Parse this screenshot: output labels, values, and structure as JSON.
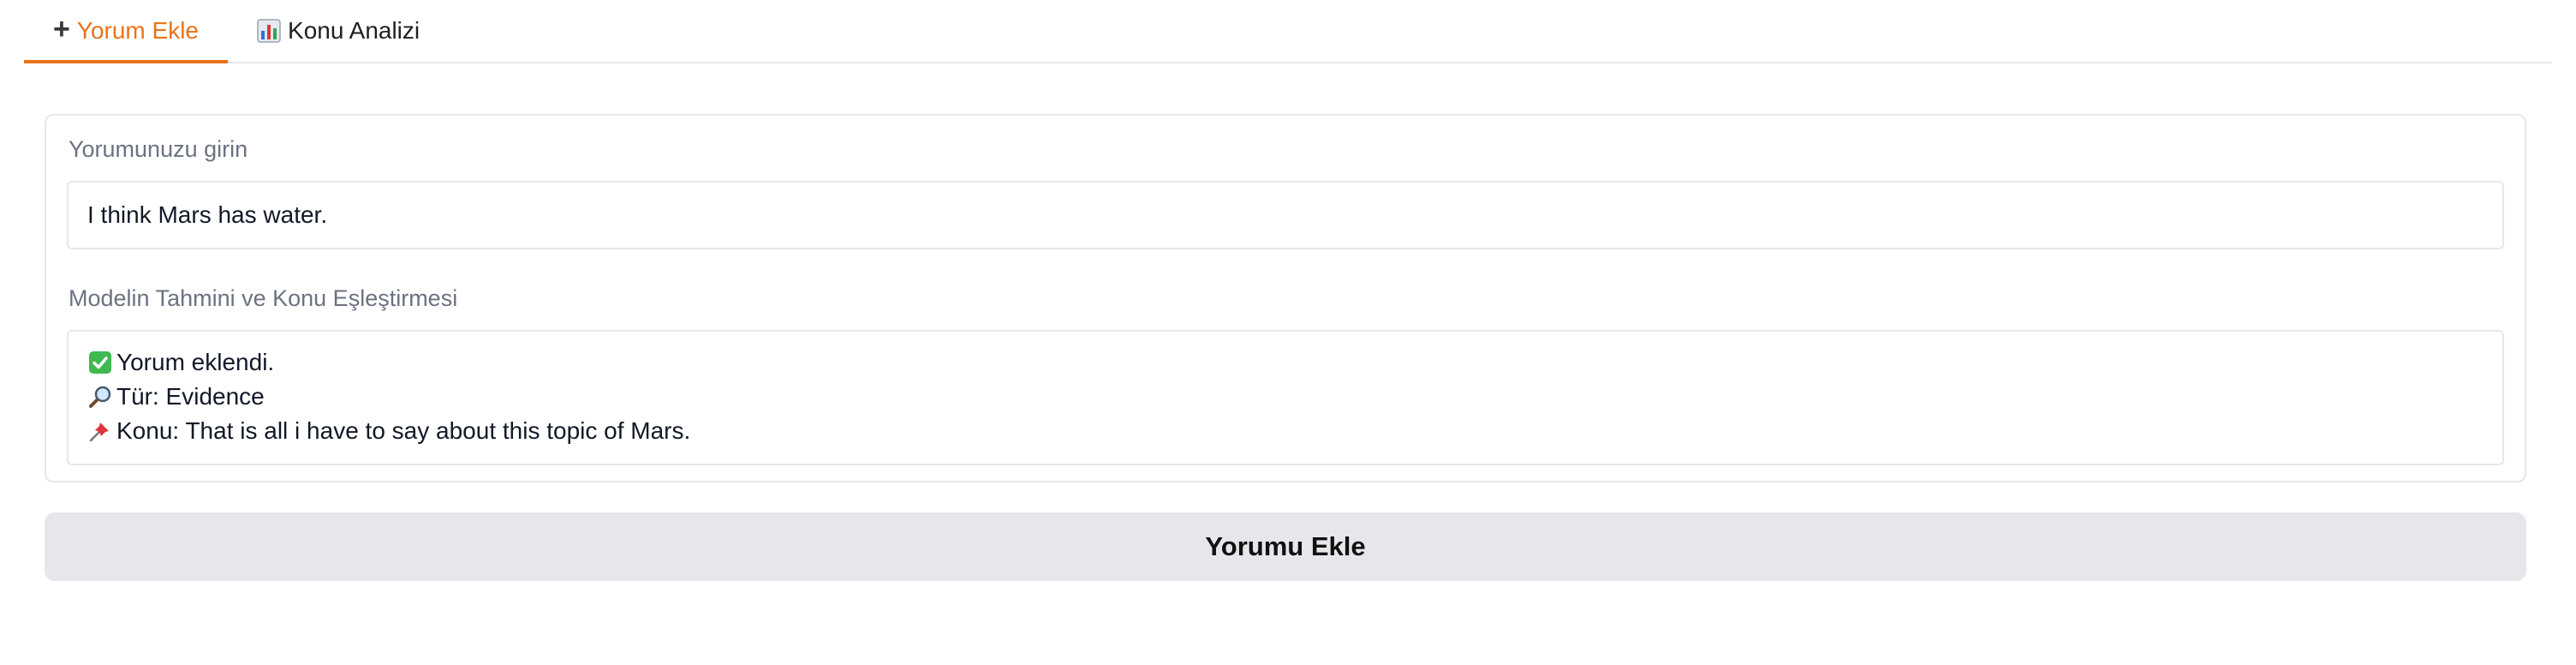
{
  "tabs": [
    {
      "label": "Yorum Ekle",
      "icon": "plus-icon",
      "active": true
    },
    {
      "label": "Konu Analizi",
      "icon": "bar-chart-icon",
      "active": false
    }
  ],
  "form": {
    "comment_label": "Yorumunuzu girin",
    "comment_value": "I think Mars has water.",
    "output_label": "Modelin Tahmini ve Konu Eşleştirmesi",
    "output_lines": [
      {
        "icon": "check-mark-icon",
        "text": "Yorum eklendi."
      },
      {
        "icon": "magnifier-icon",
        "text": "Tür: Evidence"
      },
      {
        "icon": "pushpin-icon",
        "text": "Konu: That is all i have to say about this topic of Mars."
      }
    ],
    "submit_label": "Yorumu Ekle"
  },
  "colors": {
    "accent": "#e8731a",
    "border": "#e5e7eb",
    "button_bg": "#e5e7eb",
    "label_text": "#6b7280"
  }
}
